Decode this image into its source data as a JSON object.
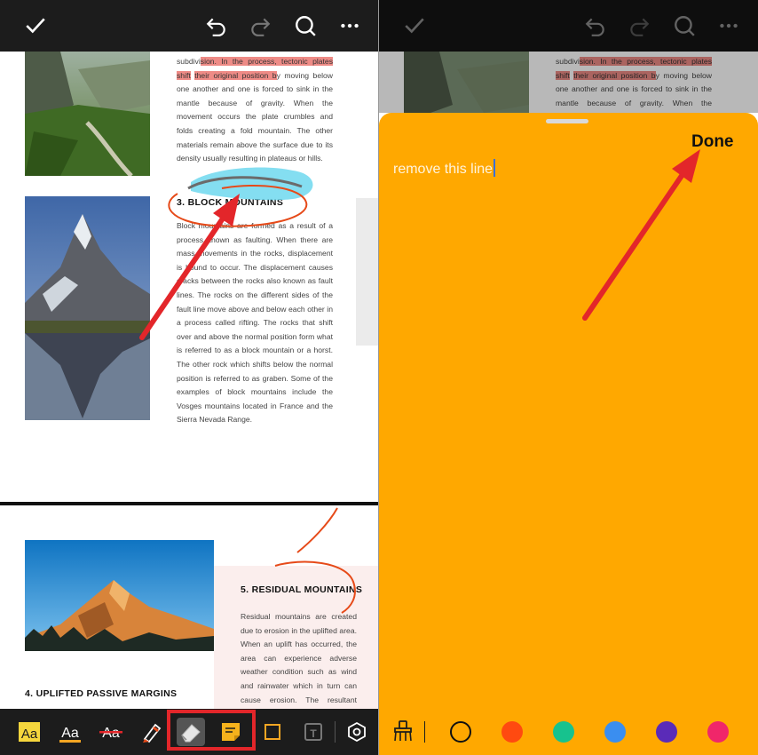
{
  "document": {
    "para1": [
      {
        "text": "subdivi",
        "hl": false
      },
      {
        "text": "sion. In the process, tectonic plates shift",
        "hl": true
      },
      {
        "text": " ",
        "hl": false
      },
      {
        "text": "their original position b",
        "hl": true
      },
      {
        "text": "y moving below one another and one is forced to sink in the mantle because of gravity. When the movement occurs the plate crumbles and folds creating a fold mountain. The other materials remain above the surface due to its density usually resulting in plateaus or hills.",
        "hl": false
      }
    ],
    "heading3": "3. BLOCK MOUNTAINS",
    "para2": "Block mountains are formed as a result of a process known as faulting. When there are mass movements in the rocks, displacement is bound to occur. The displacement causes cracks between the rocks also known as fault lines. The rocks on the different sides of the fault line move above and below each other in a process called rifting. The rocks that shift over and above the normal position form what is referred to as a block mountain or a horst. The other rock which shifts below the normal position is referred to as graben. Some of the examples of block mountains include the Vosges mountains located in France and the Sierra Nevada Range.",
    "heading5": "5. RESIDUAL MOUNTAINS",
    "para3": "Residual mountains are created due to erosion in the uplifted area. When an uplift has occurred, the area can experience adverse weather condition such as wind and rainwater which in turn can cause erosion. The resultant erosion in",
    "heading4": "4. UPLIFTED PASSIVE MARGINS"
  },
  "note": {
    "text": "remove this line",
    "done_label": "Done"
  },
  "toolbar": {
    "tools": [
      "highlight-tool",
      "underline-tool",
      "strikethrough-tool",
      "pen-tool",
      "eraser-tool",
      "sticky-note-tool",
      "rectangle-tool",
      "textbox-tool",
      "settings-tool"
    ]
  },
  "colors": {
    "accent": "#ffa800",
    "annotation_red": "#e3262a",
    "highlight": "#ee8b86",
    "swatches": [
      "#ff4a10",
      "#17c28e",
      "#3a8ef0",
      "#5a2bb8",
      "#f0266a"
    ]
  }
}
